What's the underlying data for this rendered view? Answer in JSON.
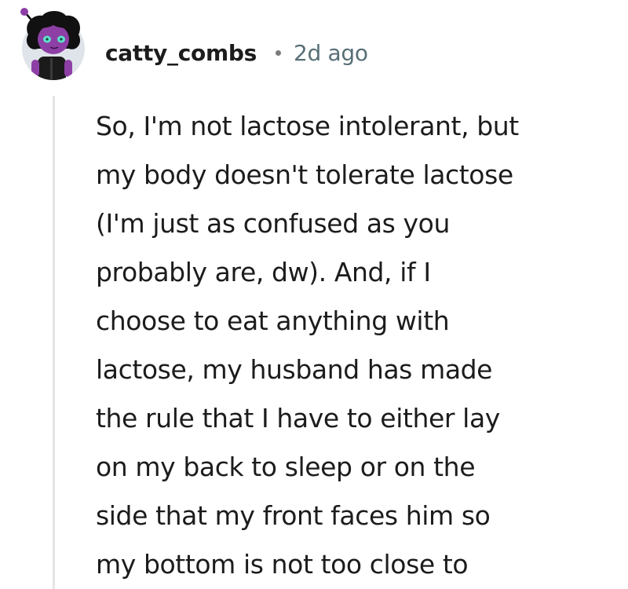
{
  "comment": {
    "username": "catty_combs",
    "timestamp": "2d ago",
    "avatar_icon": "snoo-avatar-icon",
    "body_lines": [
      "So, I'm not lactose intolerant, but",
      "my body doesn't tolerate lactose",
      "(I'm just as confused as you",
      "probably are, dw). And, if I",
      "choose to eat anything with",
      "lactose, my husband has made",
      "the rule that I have to either lay",
      "on my back to sleep or on the",
      "side that my front faces him so",
      "my bottom is not too close to"
    ]
  },
  "colors": {
    "username": "#1c1c1c",
    "timestamp": "#576f76",
    "thread_line": "#e5e5e5",
    "avatar_bg": "#dfe4ea",
    "avatar_skin": "#8e3fa6"
  }
}
